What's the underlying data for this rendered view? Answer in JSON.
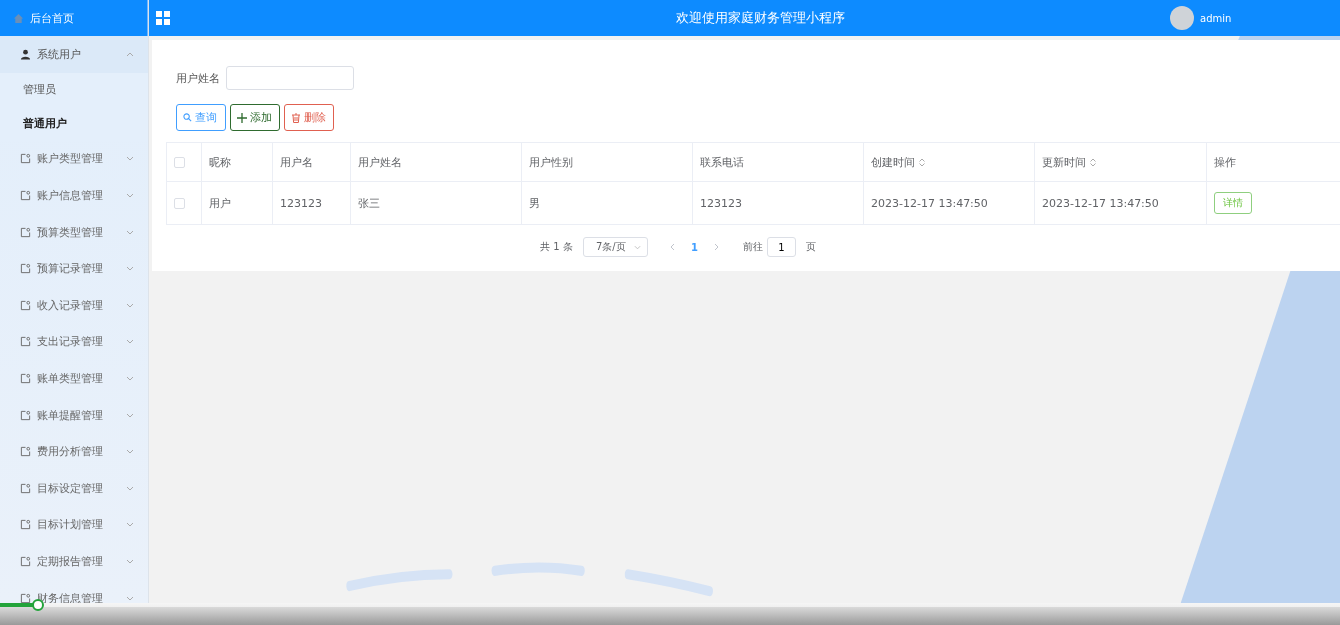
{
  "header": {
    "title": "欢迎使用家庭财务管理小程序",
    "user": "admin"
  },
  "sidebar": {
    "home": "后台首页",
    "items": [
      {
        "label": "系统用户",
        "kind": "user",
        "expanded": true,
        "children": [
          {
            "label": "管理员",
            "selected": false
          },
          {
            "label": "普通用户",
            "selected": true
          }
        ]
      },
      {
        "label": "账户类型管理",
        "kind": "doc",
        "expanded": false
      },
      {
        "label": "账户信息管理",
        "kind": "doc",
        "expanded": false
      },
      {
        "label": "预算类型管理",
        "kind": "doc",
        "expanded": false
      },
      {
        "label": "预算记录管理",
        "kind": "doc",
        "expanded": false
      },
      {
        "label": "收入记录管理",
        "kind": "doc",
        "expanded": false
      },
      {
        "label": "支出记录管理",
        "kind": "doc",
        "expanded": false
      },
      {
        "label": "账单类型管理",
        "kind": "doc",
        "expanded": false
      },
      {
        "label": "账单提醒管理",
        "kind": "doc",
        "expanded": false
      },
      {
        "label": "费用分析管理",
        "kind": "doc",
        "expanded": false
      },
      {
        "label": "目标设定管理",
        "kind": "doc",
        "expanded": false
      },
      {
        "label": "目标计划管理",
        "kind": "doc",
        "expanded": false
      },
      {
        "label": "定期报告管理",
        "kind": "doc",
        "expanded": false
      },
      {
        "label": "财务信息管理",
        "kind": "doc",
        "expanded": false
      }
    ]
  },
  "search": {
    "label": "用户姓名"
  },
  "buttons": [
    {
      "label": "查询",
      "kind": "search"
    },
    {
      "label": "添加",
      "kind": "add"
    },
    {
      "label": "删除",
      "kind": "delete"
    }
  ],
  "table": {
    "all_checked": false,
    "columns": [
      {
        "label": "昵称",
        "sortable": false
      },
      {
        "label": "用户名",
        "sortable": false
      },
      {
        "label": "用户姓名",
        "sortable": false
      },
      {
        "label": "用户性别",
        "sortable": false
      },
      {
        "label": "联系电话",
        "sortable": false
      },
      {
        "label": "创建时间",
        "sortable": true
      },
      {
        "label": "更新时间",
        "sortable": true
      },
      {
        "label": "操作",
        "sortable": false
      }
    ],
    "rows": [
      {
        "checked": false,
        "cells": [
          "用户",
          "123123",
          "张三",
          "男",
          "123123",
          "2023-12-17 13:47:50",
          "2023-12-17 13:47:50"
        ],
        "action": "详情"
      }
    ]
  },
  "pagination": {
    "total": "共 1 条",
    "page_size": "7条/页",
    "pages": [
      {
        "label": "1",
        "selected": true
      }
    ],
    "goto_label": "前往",
    "goto_value": "1",
    "page_suffix": "页"
  },
  "player": {
    "level": 0.028
  }
}
